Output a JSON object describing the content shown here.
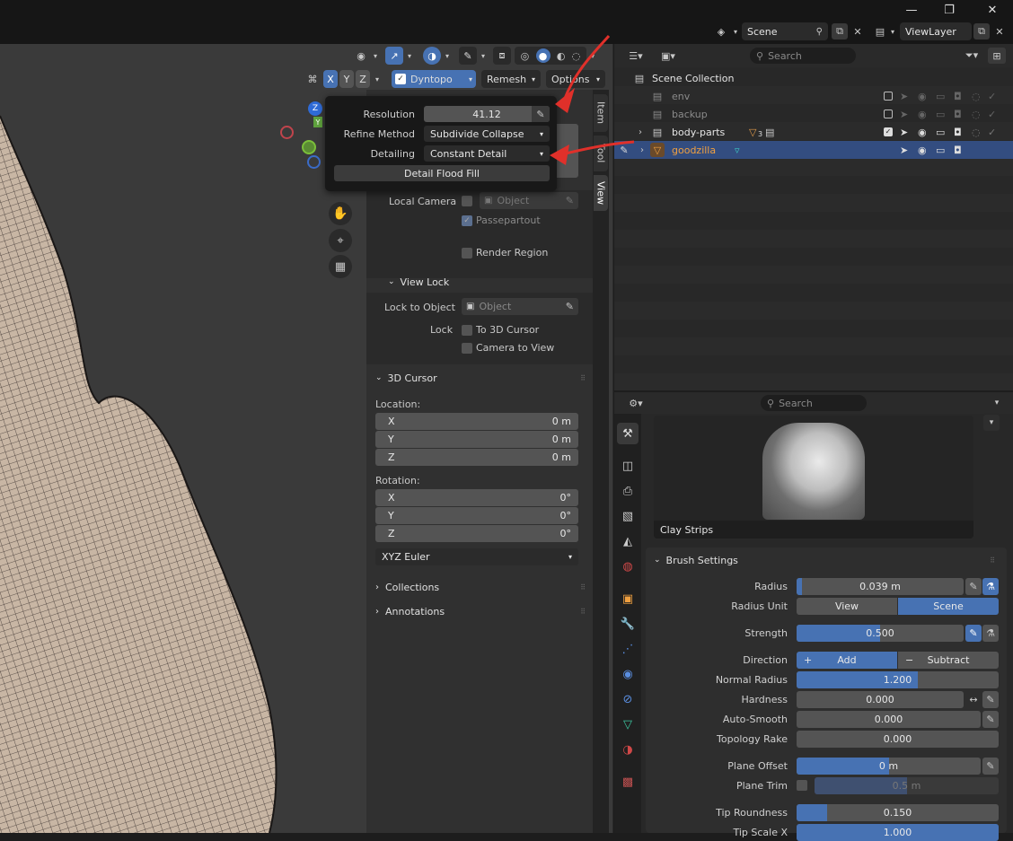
{
  "titlebar": {
    "minimize": "—",
    "maximize": "❐",
    "close": "✕"
  },
  "topbar": {
    "scene_value": "Scene",
    "viewlayer_value": "ViewLayer"
  },
  "viewport": {
    "axes": {
      "x": "X",
      "y": "Y",
      "z": "Z"
    },
    "mode_menus": {
      "dyntopo": "Dyntopo",
      "remesh": "Remesh",
      "options": "Options"
    },
    "gizmo": {
      "z": "Z",
      "y": "Y"
    }
  },
  "popup": {
    "resolution_label": "Resolution",
    "resolution_value": "41.12",
    "refine_label": "Refine Method",
    "refine_value": "Subdivide Collapse",
    "detailing_label": "Detailing",
    "detailing_value": "Constant Detail",
    "flood_fill": "Detail Flood Fill"
  },
  "sidebar_tabs": {
    "item": "Item",
    "tool": "Tool",
    "view": "View"
  },
  "npanel": {
    "local_camera_label": "Local Camera",
    "local_camera_placeholder": "Object",
    "passepartout": "Passepartout",
    "render_region": "Render Region",
    "view_lock_header": "View Lock",
    "lock_to_object_label": "Lock to Object",
    "lock_to_object_placeholder": "Object",
    "lock_label": "Lock",
    "to_3d_cursor": "To 3D Cursor",
    "camera_to_view": "Camera to View",
    "cursor_header": "3D Cursor",
    "location_label": "Location:",
    "location": [
      {
        "axis": "X",
        "value": "0 m"
      },
      {
        "axis": "Y",
        "value": "0 m"
      },
      {
        "axis": "Z",
        "value": "0 m"
      }
    ],
    "rotation_label": "Rotation:",
    "rotation": [
      {
        "axis": "X",
        "value": "0°"
      },
      {
        "axis": "Y",
        "value": "0°"
      },
      {
        "axis": "Z",
        "value": "0°"
      }
    ],
    "rotation_mode": "XYZ Euler",
    "collections_header": "Collections",
    "annotations_header": "Annotations"
  },
  "outliner": {
    "search_placeholder": "Search",
    "scene_collection": "Scene Collection",
    "items": [
      {
        "name": "env",
        "muted": true
      },
      {
        "name": "backup",
        "muted": true
      },
      {
        "name": "body-parts",
        "muted": false,
        "badge": "3"
      },
      {
        "name": "goodzilla",
        "selected": true
      }
    ]
  },
  "properties": {
    "search_placeholder": "Search",
    "brush_name": "Clay Strips",
    "brush_settings_header": "Brush Settings",
    "radius_label": "Radius",
    "radius_value": "0.039 m",
    "radius_fill": 0.03,
    "radius_unit_label": "Radius Unit",
    "radius_unit_view": "View",
    "radius_unit_scene": "Scene",
    "strength_label": "Strength",
    "strength_value": "0.500",
    "strength_fill": 0.5,
    "direction_label": "Direction",
    "direction_add": "Add",
    "direction_subtract": "Subtract",
    "normal_radius_label": "Normal Radius",
    "normal_radius_value": "1.200",
    "normal_radius_fill": 0.6,
    "hardness_label": "Hardness",
    "hardness_value": "0.000",
    "auto_smooth_label": "Auto-Smooth",
    "auto_smooth_value": "0.000",
    "topology_rake_label": "Topology Rake",
    "topology_rake_value": "0.000",
    "plane_offset_label": "Plane Offset",
    "plane_offset_value": "0 m",
    "plane_offset_fill": 0.5,
    "plane_trim_label": "Plane Trim",
    "plane_trim_value": "0.5 m",
    "tip_roundness_label": "Tip Roundness",
    "tip_roundness_value": "0.150",
    "tip_roundness_fill": 0.15,
    "tip_scale_x_label": "Tip Scale X",
    "tip_scale_x_value": "1.000"
  },
  "colors": {
    "accent": "#4772b3",
    "arrow": "#e0302a",
    "selected_object": "#f0a040"
  }
}
